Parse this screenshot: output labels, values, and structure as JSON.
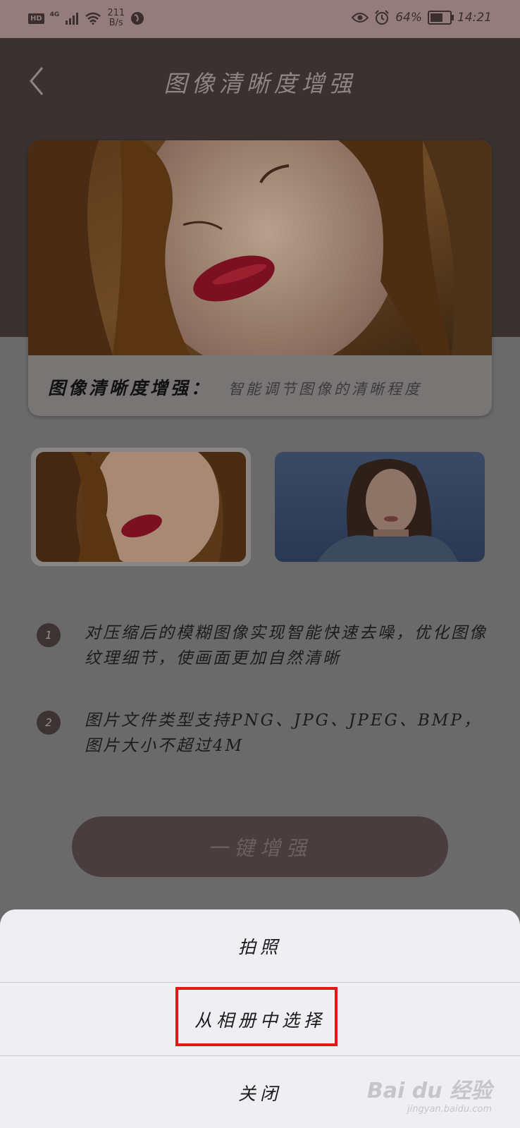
{
  "status_bar": {
    "hd": "HD",
    "network": "4G",
    "speed_value": "211",
    "speed_unit": "B/s",
    "battery": "64%",
    "battery_level": 0.64,
    "time": "14:21"
  },
  "header": {
    "title": "图像清晰度增强"
  },
  "hero": {
    "caption_title": "图像清晰度增强：",
    "caption_desc": "智能调节图像的清晰程度"
  },
  "tips": [
    {
      "num": "1",
      "text": "对压缩后的模糊图像实现智能快速去噪，优化图像 纹理细节，使画面更加自然清晰"
    },
    {
      "num": "2",
      "text": "图片文件类型支持PNG、JPG、JPEG、BMP，图片大小不超过4M"
    }
  ],
  "enhance_button": "一键增强",
  "action_sheet": {
    "take_photo": "拍照",
    "choose_album": "从相册中选择",
    "close": "关闭"
  },
  "watermark": {
    "brand": "Bai du 经验",
    "url": "jingyan.baidu.com"
  },
  "colors": {
    "header_bg": "#3a3131",
    "overlay_bg": "#6a6a6a",
    "highlight": "#e51515",
    "sheet_bg": "#efeef2"
  }
}
